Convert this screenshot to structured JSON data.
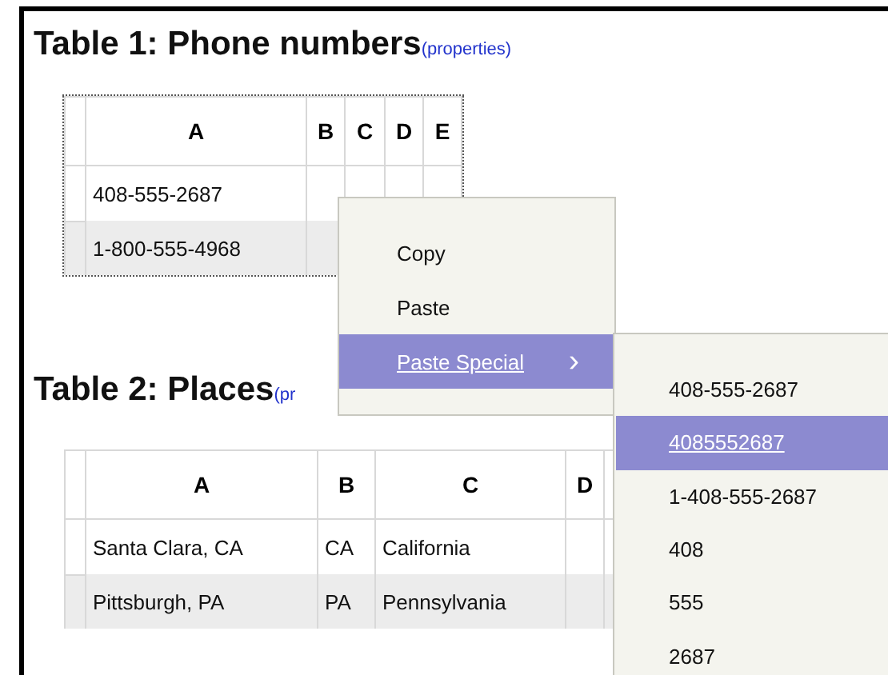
{
  "tables": [
    {
      "title": "Table 1: Phone numbers",
      "link": "(properties)",
      "columns": [
        "A",
        "B",
        "C",
        "D",
        "E"
      ],
      "rows": [
        [
          "408-555-2687",
          "",
          "",
          "",
          ""
        ],
        [
          "1-800-555-4968",
          "",
          "",
          "",
          ""
        ]
      ]
    },
    {
      "title": "Table 2: Places",
      "link": "(pr",
      "columns": [
        "A",
        "B",
        "C",
        "D",
        ""
      ],
      "rows": [
        [
          "Santa Clara, CA",
          "CA",
          "California",
          "",
          ""
        ],
        [
          "Pittsburgh, PA",
          "PA",
          "Pennsylvania",
          "",
          ""
        ]
      ]
    }
  ],
  "context_menu": {
    "items": [
      {
        "label": "Copy",
        "selected": false
      },
      {
        "label": "Paste",
        "selected": false
      },
      {
        "label": "Paste Special",
        "selected": true,
        "arrow": "›"
      }
    ]
  },
  "submenu": {
    "items": [
      {
        "label": "408-555-2687",
        "selected": false
      },
      {
        "label": "4085552687",
        "selected": true
      },
      {
        "label": "1-408-555-2687",
        "selected": false
      },
      {
        "label": "408",
        "selected": false
      },
      {
        "label": "555",
        "selected": false
      },
      {
        "label": "2687",
        "selected": false
      }
    ]
  }
}
